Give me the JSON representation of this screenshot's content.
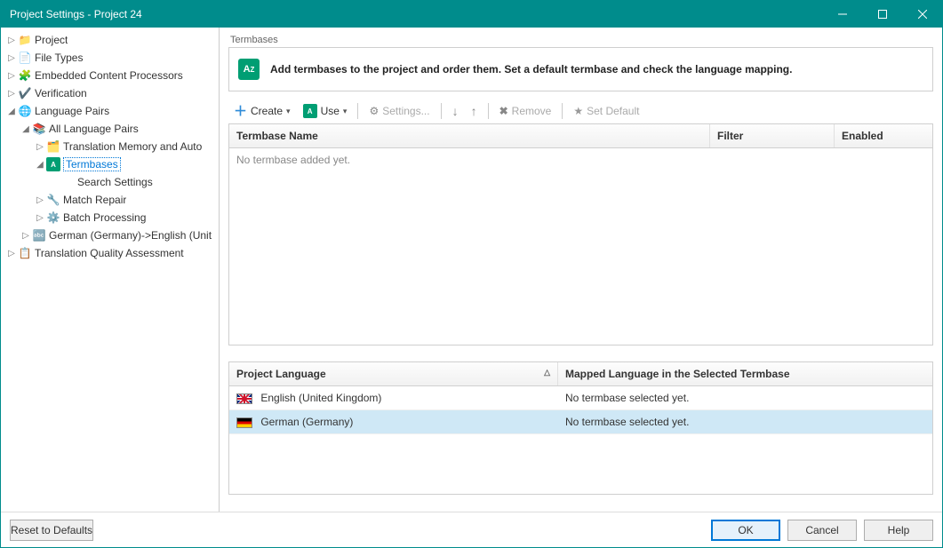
{
  "window": {
    "title": "Project Settings - Project 24"
  },
  "tree": {
    "project": "Project",
    "file_types": "File Types",
    "embedded_content": "Embedded Content Processors",
    "verification": "Verification",
    "language_pairs": "Language Pairs",
    "all_language_pairs": "All Language Pairs",
    "tm_auto": "Translation Memory and Auto",
    "termbases": "Termbases",
    "search_settings": "Search Settings",
    "match_repair": "Match Repair",
    "batch_processing": "Batch Processing",
    "german_english": "German (Germany)->English (Unit",
    "tqa": "Translation Quality Assessment"
  },
  "section": {
    "title": "Termbases",
    "description": "Add termbases to the project and order them. Set a default termbase and check the language mapping."
  },
  "toolbar": {
    "create": "Create",
    "use": "Use",
    "settings": "Settings...",
    "remove": "Remove",
    "set_default": "Set Default"
  },
  "termbase_table": {
    "col_name": "Termbase Name",
    "col_filter": "Filter",
    "col_enabled": "Enabled",
    "empty": "No termbase added yet."
  },
  "lang_table": {
    "col_project_lang": "Project Language",
    "col_mapped_lang": "Mapped Language in the Selected Termbase",
    "rows": [
      {
        "flag": "uk",
        "lang": "English (United Kingdom)",
        "mapped": "No termbase selected yet."
      },
      {
        "flag": "de",
        "lang": "German (Germany)",
        "mapped": "No termbase selected yet."
      }
    ]
  },
  "footer": {
    "reset": "Reset to Defaults",
    "ok": "OK",
    "cancel": "Cancel",
    "help": "Help"
  }
}
